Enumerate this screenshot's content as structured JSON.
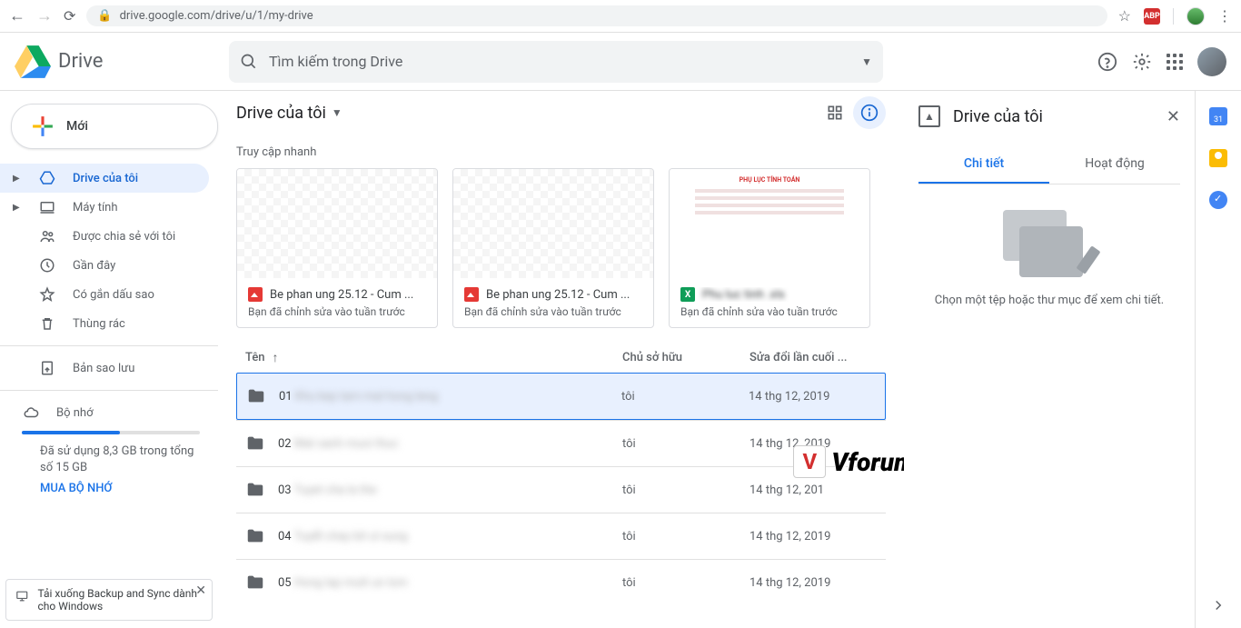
{
  "browser": {
    "url_host": "drive.google.com",
    "url_path": "/drive/u/1/my-drive",
    "abp": "ABP"
  },
  "app": {
    "name": "Drive",
    "search_placeholder": "Tìm kiếm trong Drive",
    "new_btn": "Mới"
  },
  "nav": {
    "mydrive": "Drive của tôi",
    "computers": "Máy tính",
    "shared": "Được chia sẻ với tôi",
    "recent": "Gần đây",
    "starred": "Có gắn dấu sao",
    "trash": "Thùng rác",
    "backups": "Bản sao lưu",
    "storage": "Bộ nhớ",
    "storage_used": "Đã sử dụng 8,3 GB trong tổng số 15 GB",
    "buy": "MUA BỘ NHỚ"
  },
  "toast": {
    "text": "Tải xuống Backup and Sync dành cho Windows"
  },
  "main": {
    "breadcrumb": "Drive của tôi",
    "quick_label": "Truy cập nhanh",
    "col_name": "Tên",
    "col_owner": "Chủ sở hữu",
    "col_mod": "Sửa đổi lần cuối ..."
  },
  "quick": [
    {
      "title": "Be phan ung 25.12 - Cum ...",
      "sub": "Bạn đã chỉnh sửa vào tuần trước",
      "type": "img"
    },
    {
      "title": "Be phan ung 25.12 - Cum ...",
      "sub": "Bạn đã chỉnh sửa vào tuần trước",
      "type": "img"
    },
    {
      "title": "Phu luc tinh .xls",
      "sub": "Bạn đã chỉnh sửa vào tuần trước",
      "type": "xls"
    }
  ],
  "doc_thumb_title": "PHỤ LỤC TÍNH TOÁN",
  "files": [
    {
      "prefix": "01",
      "blur": "Khu kep tarn mal hong leng",
      "owner": "tôi",
      "mod": "14 thg 12, 2019"
    },
    {
      "prefix": "02",
      "blur": "Mat sanh muoi thuc",
      "owner": "tôi",
      "mod": "14 thg 12, 2019"
    },
    {
      "prefix": "03",
      "blur": "Tuyet cha la the",
      "owner": "tôi",
      "mod": "14 thg 12, 201"
    },
    {
      "prefix": "04",
      "blur": "Tuyết chay bit ul sung",
      "owner": "tôi",
      "mod": "14 thg 12, 2019"
    },
    {
      "prefix": "05",
      "blur": "Hong lap mutt un lom",
      "owner": "tôi",
      "mod": "14 thg 12, 2019"
    }
  ],
  "details": {
    "title": "Drive của tôi",
    "tab_detail": "Chi tiết",
    "tab_activity": "Hoạt động",
    "empty_msg": "Chọn một tệp hoặc thư mục để xem chi tiết."
  },
  "rail_cal": "31",
  "watermark": "Vforum.vn"
}
